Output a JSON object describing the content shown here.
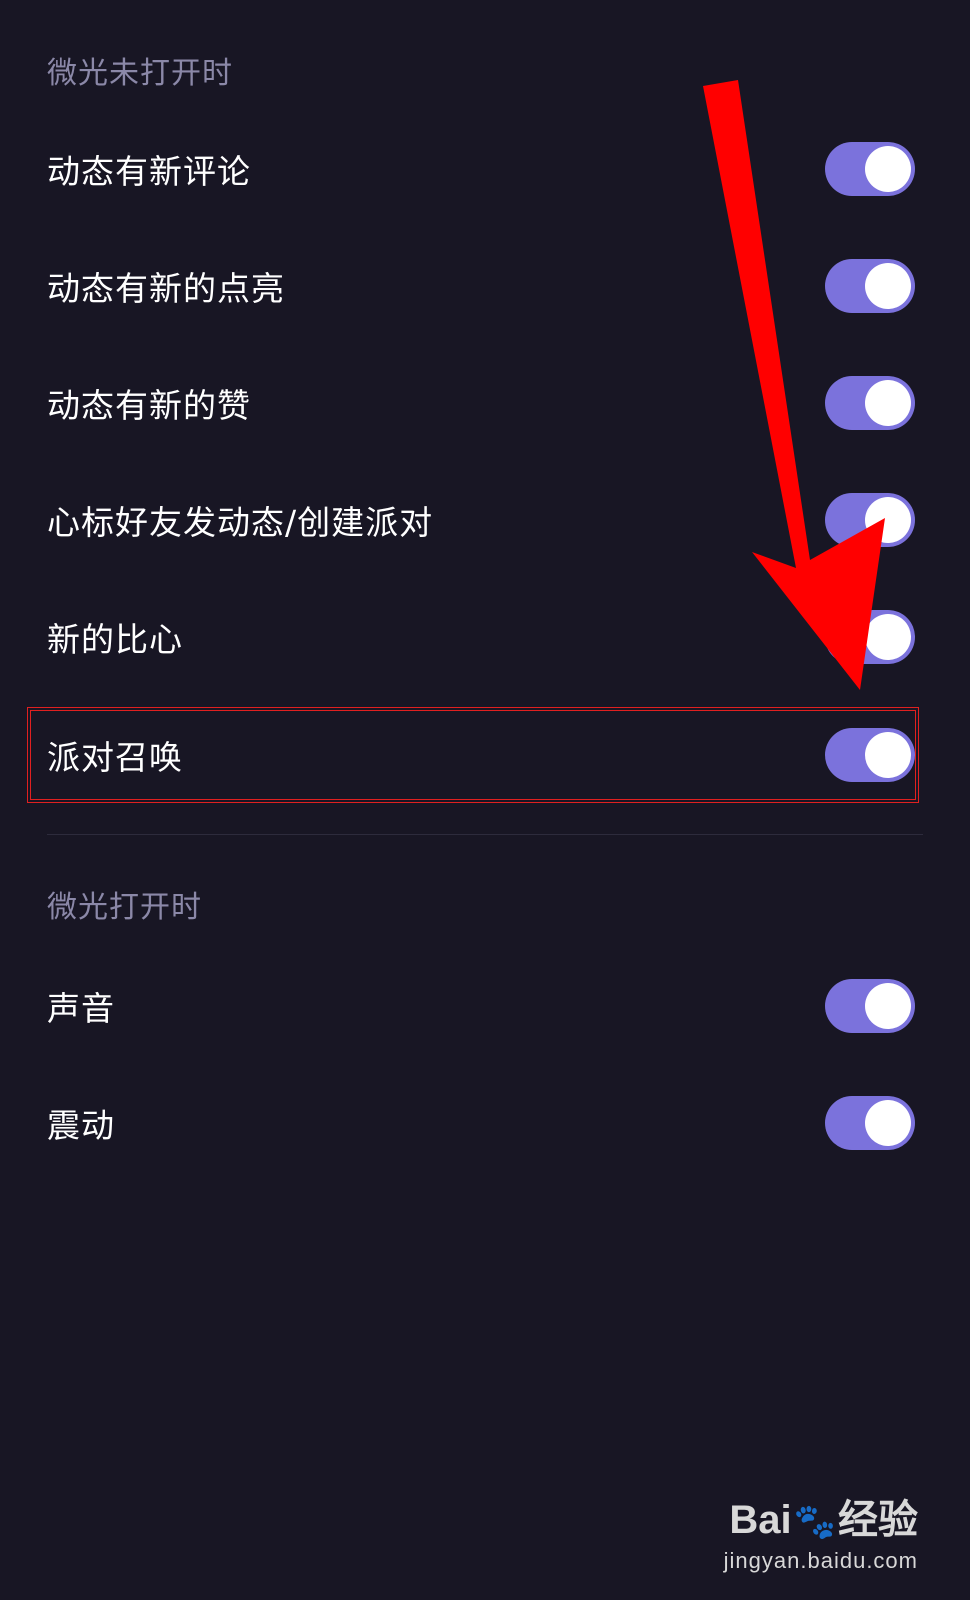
{
  "sections": [
    {
      "title": "微光未打开时",
      "items": [
        {
          "label": "动态有新评论",
          "on": true
        },
        {
          "label": "动态有新的点亮",
          "on": true
        },
        {
          "label": "动态有新的赞",
          "on": true
        },
        {
          "label": "心标好友发动态/创建派对",
          "on": true
        },
        {
          "label": "新的比心",
          "on": true
        },
        {
          "label": "派对召唤",
          "on": true
        }
      ]
    },
    {
      "title": "微光打开时",
      "items": [
        {
          "label": "声音",
          "on": true
        },
        {
          "label": "震动",
          "on": true
        }
      ]
    }
  ],
  "highlighted_item": "派对召唤",
  "colors": {
    "background": "#181624",
    "toggle_on": "#7b72dc",
    "section_title": "#8b88a8",
    "annotation_red": "#ff0000"
  },
  "watermark": {
    "logo_prefix": "Bai",
    "logo_paw": "🐾",
    "logo_suffix": "经验",
    "url": "jingyan.baidu.com"
  }
}
